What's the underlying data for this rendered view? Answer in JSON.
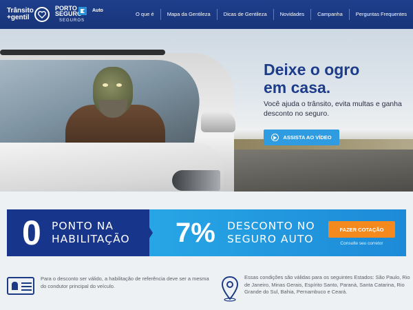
{
  "brand": {
    "transito_line1": "Trânsito",
    "transito_line2": "+gentil",
    "porto_line1": "PORTO",
    "porto_line2": "SEGURO",
    "porto_sub": "SEGUROS",
    "auto": "Auto"
  },
  "nav": {
    "items": [
      "O que é",
      "Mapa da Gentileza",
      "Dicas de Gentileza",
      "Novidades",
      "Campanha",
      "Perguntas Frequentes"
    ]
  },
  "hero": {
    "title_line1": "Deixe o ogro",
    "title_line2": "em casa.",
    "subtitle": "Você ajuda o trânsito, evita multas e ganha desconto no seguro.",
    "video_button": "ASSISTA AO VÍDEO"
  },
  "banner": {
    "zero": "0",
    "left_line1": "PONTO NA",
    "left_line2": "HABILITAÇÃO",
    "percent": "7%",
    "right_line1": "DESCONTO NO",
    "right_line2": "SEGURO AUTO",
    "quote_button": "FAZER COTAÇÃO",
    "broker_text": "Consulte seu corretor"
  },
  "info": {
    "left_text": "Para o desconto ser válido, a habilitação de referência deve ser a mesma do condutor principal do veículo.",
    "right_text": "Essas condições são válidas para os seguintes Estados: São Paulo, Rio de Janeiro, Minas Gerais, Espírito Santo, Paraná, Santa Catarina, Rio Grande do Sul, Bahia, Pernambuco e Ceará."
  },
  "icons": [
    "heart-icon",
    "flag-icon",
    "play-icon",
    "id-card-icon",
    "map-pin-icon"
  ],
  "colors": {
    "nav": "#1e3f8c",
    "title_blue": "#1d3c89",
    "video_button": "#2f9be0",
    "banner_dark": "#18358c",
    "banner_light": "#27a6e5",
    "quote_button": "#f48a1d"
  }
}
